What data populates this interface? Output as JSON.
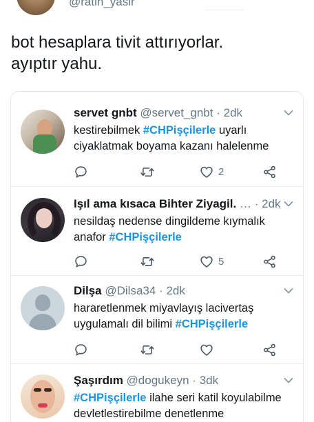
{
  "header": {
    "handle": "@ratin_yasir"
  },
  "tweet": {
    "text_line1": "bot hesaplara tivit attırıyorlar.",
    "text_line2": "ayıptır yahu."
  },
  "replies": [
    {
      "name": "servet gnbt",
      "handle": "@servet_gnbt",
      "dot": "·",
      "time": "2dk",
      "line1_pre": "kestirebilmek ",
      "line1_tag": "#CHPişçilerle",
      "line1_post": " uyarlı",
      "line2_pre": "ciyaklatmak boyama kazanı halelenme",
      "line2_tag": "",
      "line2_post": "",
      "likes": "2",
      "avatar": "avatar-photo"
    },
    {
      "name": "Işıl ama kısaca Bihter Ziyagil.",
      "handle": "…",
      "dot": "·",
      "time": "2dk",
      "line1_pre": "nesildaş nedense dingildeme kıymalık",
      "line1_tag": "",
      "line1_post": "",
      "line2_pre": "anafor ",
      "line2_tag": "#CHPişçilerle",
      "line2_post": "",
      "likes": "5",
      "avatar": "avatar-photo"
    },
    {
      "name": "Dilşa",
      "handle": "@Dilsa34",
      "dot": "·",
      "time": "2dk",
      "line1_pre": "hararetlenmek miyavlayış lacivertaş",
      "line1_tag": "",
      "line1_post": "",
      "line2_pre": "uygulamalı dil bilimi ",
      "line2_tag": "#CHPişçilerle",
      "line2_post": "",
      "likes": "",
      "avatar": "default-avatar"
    },
    {
      "name": "Şaşırdım",
      "handle": "@dogukeyn",
      "dot": "·",
      "time": "3dk",
      "line1_pre": "",
      "line1_tag": "#CHPişçilerle",
      "line1_post": " ilahe seri katil koyulabilme",
      "line2_pre": "devletlestirebilme denetlenme",
      "line2_tag": "",
      "line2_post": "",
      "likes": "",
      "avatar": "avatar-photo"
    }
  ],
  "icons": {
    "reply": "reply-icon",
    "retweet": "retweet-icon",
    "like": "heart-icon",
    "share": "share-icon",
    "menu": "chevron-down-icon"
  },
  "colors": {
    "hashtag": "#1b95e0",
    "secondary_text": "#657786",
    "icon": "#4a5560",
    "border": "#e1e8ed"
  }
}
